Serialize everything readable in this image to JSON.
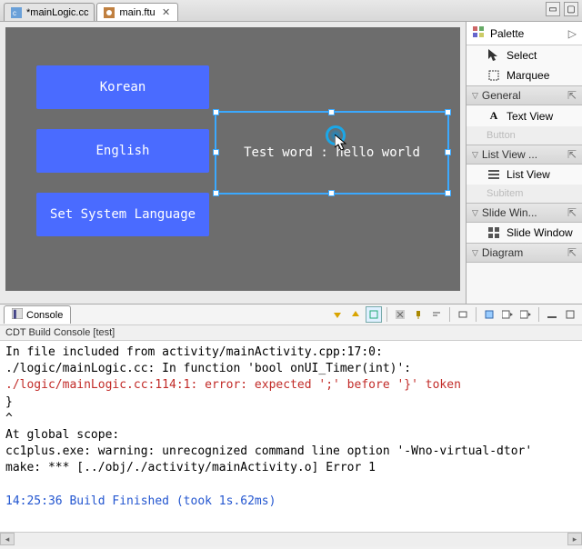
{
  "tabs": [
    {
      "label": "*mainLogic.cc",
      "dirty": "*",
      "active": false
    },
    {
      "label": "main.ftu",
      "dirty": "",
      "active": true
    }
  ],
  "canvas": {
    "buttons": {
      "korean": "Korean",
      "english": "English",
      "setlang": "Set System Language"
    },
    "textview": "Test word : hello world"
  },
  "palette": {
    "title": "Palette",
    "tools": {
      "select": "Select",
      "marquee": "Marquee"
    },
    "drawers": {
      "general": "General",
      "listview": "List View ...",
      "slidewin": "Slide Win...",
      "diagram": "Diagram"
    },
    "items": {
      "textview": "Text View",
      "button_ghost": "Button",
      "listview": "List View",
      "subitem_ghost": "Subitem",
      "slidewindow": "Slide Window"
    }
  },
  "console": {
    "tab": "Console",
    "subtitle": "CDT Build Console [test]",
    "lines": [
      {
        "cls": "cl-black",
        "text": "In file included from activity/mainActivity.cpp:17:0:"
      },
      {
        "cls": "cl-black",
        "text": "./logic/mainLogic.cc: In function 'bool onUI_Timer(int)':"
      },
      {
        "cls": "cl-red",
        "text": "./logic/mainLogic.cc:114:1: error: expected ';' before '}' token"
      },
      {
        "cls": "cl-black",
        "text": " }"
      },
      {
        "cls": "cl-black",
        "text": " ^"
      },
      {
        "cls": "cl-black",
        "text": "At global scope:"
      },
      {
        "cls": "cl-black",
        "text": "cc1plus.exe: warning: unrecognized command line option '-Wno-virtual-dtor'"
      },
      {
        "cls": "cl-black",
        "text": "make: *** [../obj/./activity/mainActivity.o] Error 1"
      },
      {
        "cls": "cl-black",
        "text": ""
      },
      {
        "cls": "cl-blue",
        "text": "14:25:36 Build Finished (took 1s.62ms)"
      }
    ]
  },
  "colors": {
    "accent": "#4a6bff",
    "selection": "#3ba9ff"
  }
}
